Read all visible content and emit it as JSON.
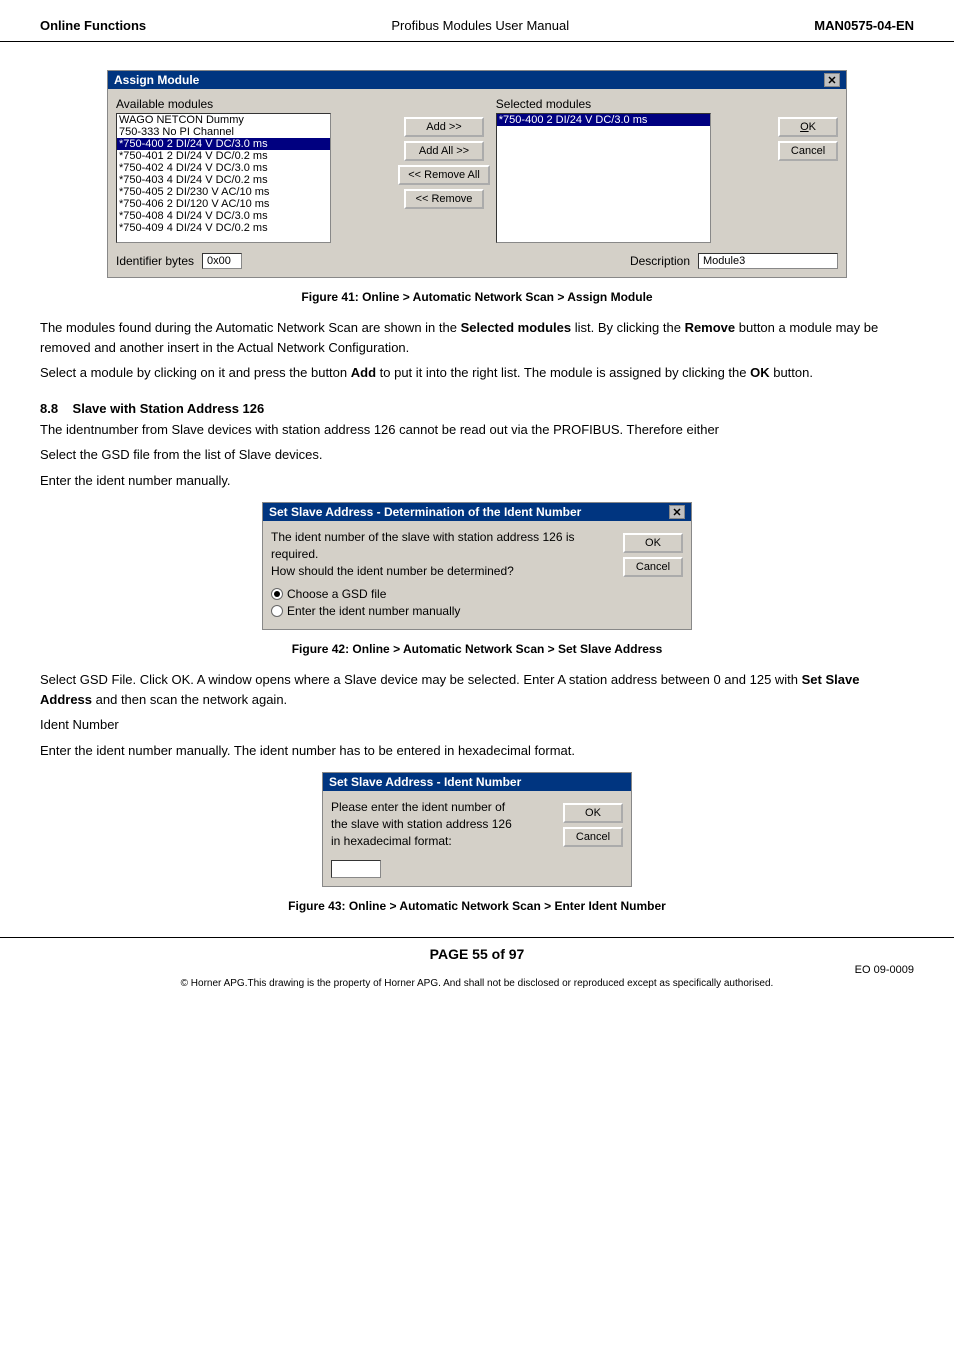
{
  "header": {
    "left": "Online Functions",
    "center": "Profibus Modules User Manual",
    "right": "MAN0575-04-EN"
  },
  "figure41": {
    "title": "Assign Module",
    "available_label": "Available modules",
    "selected_label": "Selected modules",
    "available_items": [
      "WAGO NETCON Dummy",
      "750-333 No PI Channel",
      "*750-400  2 DI/24 V DC/3.0 ms",
      "*750-401  2 DI/24 V DC/0.2 ms",
      "*750-402  4 DI/24 V DC/3.0 ms",
      "*750-403  4 DI/24 V DC/0.2 ms",
      "*750-405  2 DI/230 V AC/10 ms",
      "*750-406  2 DI/120 V AC/10 ms",
      "*750-408  4 DI/24 V DC/3.0 ms",
      "*750-409  4 DI/24 V DC/0.2 ms"
    ],
    "selected_item": "*750-400  2 DI/24 V DC/3.0 ms",
    "add_btn": "Add >>",
    "add_all_btn": "Add All >>",
    "remove_all_btn": "<< Remove All",
    "remove_btn": "<< Remove",
    "ok_btn": "OK",
    "cancel_btn": "Cancel",
    "identifier_label": "Identifier bytes",
    "identifier_value": "0x00",
    "description_label": "Description",
    "description_value": "Module3",
    "caption": "Figure 41: Online > Automatic Network Scan > Assign Module"
  },
  "body_text1": "The modules found during the Automatic Network Scan are shown in the ",
  "body_text1_bold": "Selected modules",
  "body_text1_end": " list.  By clicking the ",
  "body_text1_remove_bold": "Remove",
  "body_text1_end2": " button a module may be removed and another insert in the Actual Network Configuration.",
  "body_text2": "Select a module by clicking on it and press the button ",
  "body_text2_bold": "Add",
  "body_text2_end": " to put it into the right list. The module is assigned by clicking the ",
  "body_text2_ok_bold": "OK",
  "body_text2_end2": " button.",
  "section88": {
    "number": "8.8",
    "title": "Slave with Station Address 126",
    "para1": "The identnumber from Slave devices with station address 126 cannot be read out via the PROFIBUS. Therefore either",
    "para2": "Select the GSD file from the list of Slave devices.",
    "para3": "Enter the ident number manually."
  },
  "figure42": {
    "title": "Set Slave Address - Determination of the Ident Number",
    "text1": "The ident number of the slave with station address 126 is required.",
    "text2": "How should the ident number be determined?",
    "radio1": "Choose a GSD file",
    "radio2": "Enter the ident number manually",
    "ok_btn": "OK",
    "cancel_btn": "Cancel",
    "caption": "Figure 42: Online > Automatic Network Scan > Set Slave Address"
  },
  "body_text3": "Select GSD File.  Click OK.  A window opens where a Slave device may be selected.  Enter A station address between 0 and 125 with ",
  "body_text3_bold": "Set Slave Address",
  "body_text3_end": " and then scan the network again.",
  "body_text4_label": "Ident Number",
  "body_text4": "Enter the ident number manually.  The ident number has to be entered in hexadecimal format.",
  "figure43": {
    "title": "Set Slave Address - Ident Number",
    "text1": "Please enter the ident number of",
    "text2": "the slave with station address 126",
    "text3": "in hexadecimal format:",
    "ok_btn": "OK",
    "cancel_btn": "Cancel",
    "caption": "Figure 43: Online > Automatic Network Scan > Enter Ident Number"
  },
  "footer": {
    "page": "PAGE 55 of 97",
    "eo": "EO 09-0009",
    "copyright": "© Horner APG.This drawing is the property of Horner APG. And shall not be disclosed or reproduced except as specifically authorised."
  }
}
